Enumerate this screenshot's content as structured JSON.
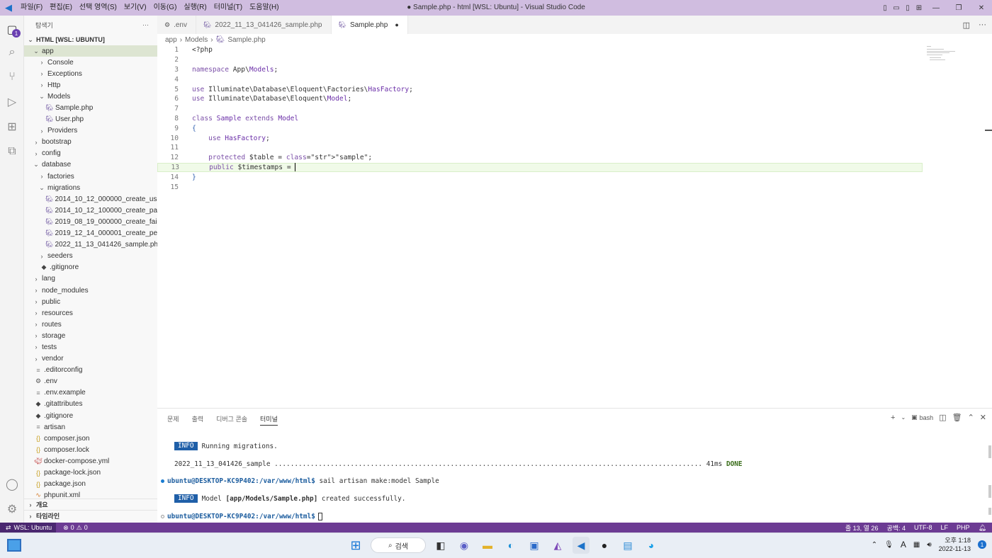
{
  "window": {
    "title": "● Sample.php - html [WSL: Ubuntu] - Visual Studio Code",
    "menu": [
      "파일(F)",
      "편집(E)",
      "선택 영역(S)",
      "보기(V)",
      "이동(G)",
      "실행(R)",
      "터미널(T)",
      "도움말(H)"
    ]
  },
  "activity": {
    "explorer_badge": "1"
  },
  "explorer": {
    "header": "탐색기",
    "more": "···",
    "root": "HTML [WSL: UBUNTU]",
    "items": [
      {
        "label": "app",
        "depth": 0,
        "type": "folder-open",
        "selected": true
      },
      {
        "label": "Console",
        "depth": 1,
        "type": "folder"
      },
      {
        "label": "Exceptions",
        "depth": 1,
        "type": "folder"
      },
      {
        "label": "Http",
        "depth": 1,
        "type": "folder"
      },
      {
        "label": "Models",
        "depth": 1,
        "type": "folder-open"
      },
      {
        "label": "Sample.php",
        "depth": 2,
        "type": "php"
      },
      {
        "label": "User.php",
        "depth": 2,
        "type": "php"
      },
      {
        "label": "Providers",
        "depth": 1,
        "type": "folder"
      },
      {
        "label": "bootstrap",
        "depth": 0,
        "type": "folder"
      },
      {
        "label": "config",
        "depth": 0,
        "type": "folder"
      },
      {
        "label": "database",
        "depth": 0,
        "type": "folder-open"
      },
      {
        "label": "factories",
        "depth": 1,
        "type": "folder"
      },
      {
        "label": "migrations",
        "depth": 1,
        "type": "folder-open"
      },
      {
        "label": "2014_10_12_000000_create_users_...",
        "depth": 2,
        "type": "php"
      },
      {
        "label": "2014_10_12_100000_create_passw...",
        "depth": 2,
        "type": "php"
      },
      {
        "label": "2019_08_19_000000_create_failed...",
        "depth": 2,
        "type": "php"
      },
      {
        "label": "2019_12_14_000001_create_perso...",
        "depth": 2,
        "type": "php"
      },
      {
        "label": "2022_11_13_041426_sample.php",
        "depth": 2,
        "type": "php"
      },
      {
        "label": "seeders",
        "depth": 1,
        "type": "folder"
      },
      {
        "label": ".gitignore",
        "depth": 1,
        "type": "git"
      },
      {
        "label": "lang",
        "depth": 0,
        "type": "folder"
      },
      {
        "label": "node_modules",
        "depth": 0,
        "type": "folder"
      },
      {
        "label": "public",
        "depth": 0,
        "type": "folder"
      },
      {
        "label": "resources",
        "depth": 0,
        "type": "folder"
      },
      {
        "label": "routes",
        "depth": 0,
        "type": "folder"
      },
      {
        "label": "storage",
        "depth": 0,
        "type": "folder"
      },
      {
        "label": "tests",
        "depth": 0,
        "type": "folder"
      },
      {
        "label": "vendor",
        "depth": 0,
        "type": "folder"
      },
      {
        "label": ".editorconfig",
        "depth": 0,
        "type": "lines"
      },
      {
        "label": ".env",
        "depth": 0,
        "type": "gear"
      },
      {
        "label": ".env.example",
        "depth": 0,
        "type": "lines"
      },
      {
        "label": ".gitattributes",
        "depth": 0,
        "type": "git"
      },
      {
        "label": ".gitignore",
        "depth": 0,
        "type": "git"
      },
      {
        "label": "artisan",
        "depth": 0,
        "type": "lines"
      },
      {
        "label": "composer.json",
        "depth": 0,
        "type": "json"
      },
      {
        "label": "composer.lock",
        "depth": 0,
        "type": "json"
      },
      {
        "label": "docker-compose.yml",
        "depth": 0,
        "type": "docker"
      },
      {
        "label": "package-lock.json",
        "depth": 0,
        "type": "json"
      },
      {
        "label": "package.json",
        "depth": 0,
        "type": "json"
      },
      {
        "label": "phpunit.xml",
        "depth": 0,
        "type": "rss"
      }
    ],
    "outline": "개요",
    "timeline": "타임라인"
  },
  "tabs": [
    {
      "label": ".env",
      "icon": "gear",
      "active": false
    },
    {
      "label": "2022_11_13_041426_sample.php",
      "icon": "php",
      "active": false
    },
    {
      "label": "Sample.php",
      "icon": "php",
      "active": true,
      "dirty": "●"
    }
  ],
  "breadcrumb": [
    "app",
    "Models",
    "Sample.php"
  ],
  "editor": {
    "current_line": 13,
    "lines": [
      "<?php",
      "",
      "namespace App\\Models;",
      "",
      "use Illuminate\\Database\\Eloquent\\Factories\\HasFactory;",
      "use Illuminate\\Database\\Eloquent\\Model;",
      "",
      "class Sample extends Model",
      "{",
      "    use HasFactory;",
      "",
      "    protected $table = \"sample\";",
      "    public $timestamps = ",
      "}",
      ""
    ]
  },
  "panel": {
    "tabs": [
      "문제",
      "출력",
      "디버그 콘솔",
      "터미널"
    ],
    "active_tab": "터미널",
    "shell": "bash",
    "terminal": {
      "info1_badge": "INFO",
      "info1_text": "Running migrations.",
      "migration_name": "2022_11_13_041426_sample",
      "migration_dots": " ...........................................................................................................",
      "migration_time": " 41ms",
      "migration_status": "DONE",
      "prompt1": "ubuntu@DESKTOP-KC9P402:/var/www/html$",
      "cmd1": " sail artisan make:model Sample",
      "info2_badge": "INFO",
      "info2_pre": "Model ",
      "info2_bold": "[app/Models/Sample.php]",
      "info2_post": " created successfully.",
      "prompt2": "ubuntu@DESKTOP-KC9P402:/var/www/html$"
    }
  },
  "statusbar": {
    "remote": "WSL: Ubuntu",
    "errors": "0",
    "warnings": "0",
    "position": "줄 13, 열 26",
    "spaces": "공백: 4",
    "encoding": "UTF-8",
    "eol": "LF",
    "language": "PHP"
  },
  "taskbar": {
    "search": "검색",
    "time": "오후 1:18",
    "date": "2022-11-13",
    "notifications": "1",
    "ime": "A"
  }
}
